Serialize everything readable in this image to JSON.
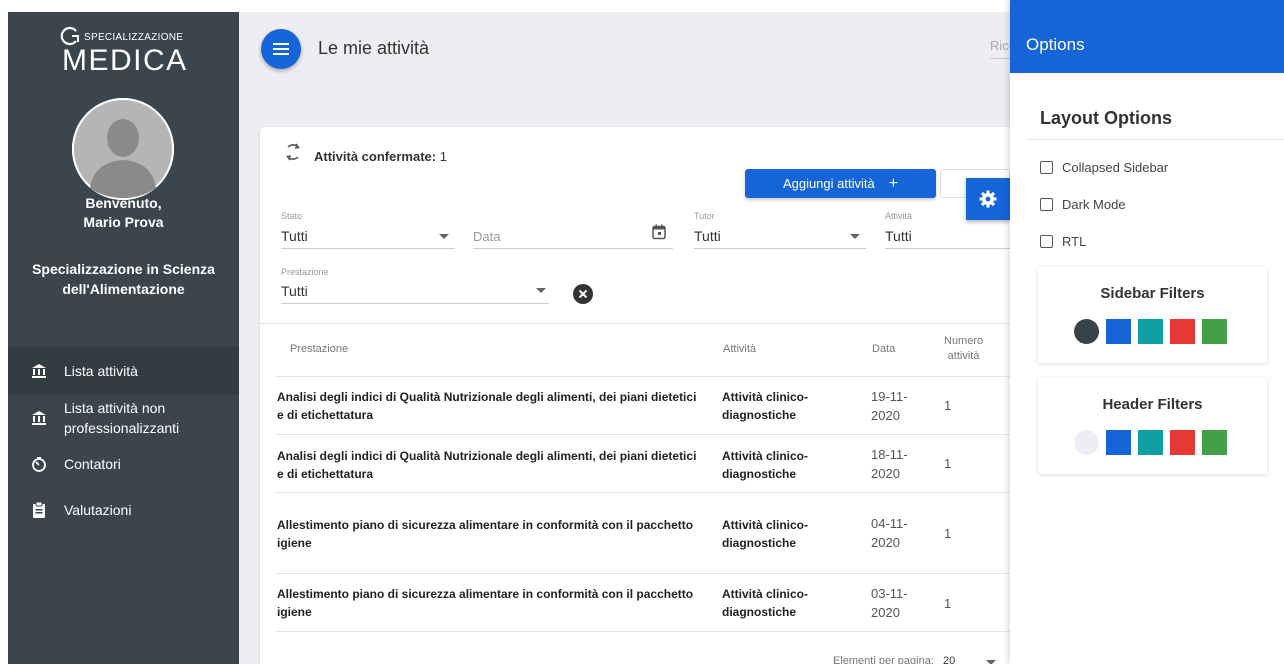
{
  "brand": {
    "small": "SPECIALIZZAZIONE",
    "main": "MEDICA"
  },
  "user": {
    "greeting": "Benvenuto,",
    "name": "Mario Prova",
    "specialization_line1": "Specializzazione in Scienza",
    "specialization_line2": "dell'Alimentazione"
  },
  "nav": [
    {
      "label": "Lista attività",
      "icon": "bank-icon",
      "active": true
    },
    {
      "label_line1": "Lista attività non",
      "label_line2": "professionalizzanti",
      "icon": "bank-icon"
    },
    {
      "label": "Contatori",
      "icon": "timer-icon"
    },
    {
      "label": "Valutazioni",
      "icon": "clipboard-icon"
    }
  ],
  "header": {
    "title": "Le mie attività",
    "search_placeholder": "Ricerca"
  },
  "card": {
    "title": "Attività confermate:",
    "count": "1",
    "add_button": "Aggiungi attività",
    "add_button_plus": "+"
  },
  "filters": {
    "stato": {
      "label": "Stato",
      "value": "Tutti"
    },
    "data": {
      "placeholder": "Data"
    },
    "tutor": {
      "label": "Tutor",
      "value": "Tutti"
    },
    "attivita": {
      "label": "Attività",
      "value": "Tutti"
    },
    "prestazione": {
      "label": "Prestazione",
      "value": "Tutti"
    }
  },
  "table": {
    "headers": {
      "prestazione": "Prestazione",
      "attivita": "Attività",
      "data": "Data",
      "numero_line1": "Numero",
      "numero_line2": "attività"
    },
    "rows": [
      {
        "prest1": "Analisi degli indici di Qualità Nutrizionale degli alimenti, dei piani dietetici",
        "prest2": "e di etichettatura",
        "att1": "Attività clinico-",
        "att2": "diagnostiche",
        "date1": "19-11-",
        "date2": "2020",
        "num": "1"
      },
      {
        "prest1": "Analisi degli indici di Qualità Nutrizionale degli alimenti, dei piani dietetici",
        "prest2": "e di etichettatura",
        "att1": "Attività clinico-",
        "att2": "diagnostiche",
        "date1": "18-11-",
        "date2": "2020",
        "num": "1"
      },
      {
        "prest1": "Allestimento piano di sicurezza alimentare in conformità con il pacchetto",
        "prest2": "igiene",
        "att1": "Attività clinico-",
        "att2": "diagnostiche",
        "date1": "04-11-",
        "date2": "2020",
        "num": "1"
      },
      {
        "prest1": "Allestimento piano di sicurezza alimentare in conformità con il pacchetto",
        "prest2": "igiene",
        "att1": "Attività clinico-",
        "att2": "diagnostiche",
        "date1": "03-11-",
        "date2": "2020",
        "num": "1"
      }
    ],
    "footer": "Elementi per pagina:",
    "page_size": "20"
  },
  "options": {
    "title": "Options",
    "layout_title": "Layout Options",
    "items": [
      "Collapsed Sidebar",
      "Dark Mode",
      "RTL"
    ],
    "sidebar_filters": {
      "title": "Sidebar Filters",
      "colors": [
        "#37434b",
        "#1565d8",
        "#0e9fa2",
        "#e53935",
        "#43a047"
      ]
    },
    "header_filters": {
      "title": "Header Filters",
      "colors": [
        "#eceef4",
        "#1565d8",
        "#0e9fa2",
        "#e53935",
        "#43a047"
      ]
    }
  }
}
